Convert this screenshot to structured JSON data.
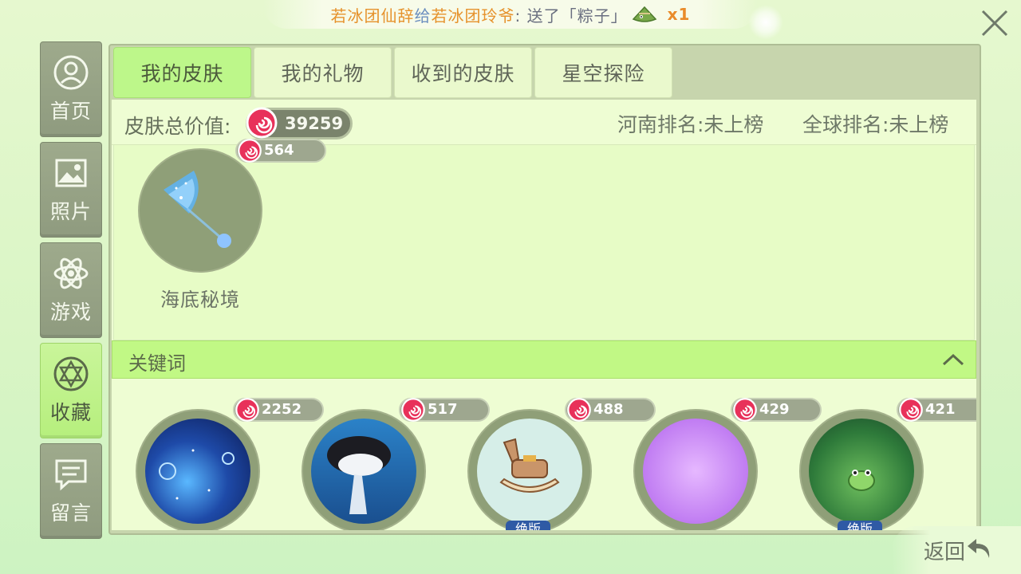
{
  "notification": {
    "sender": "若冰团仙辞",
    "connector": "给",
    "receiver": "若冰团玲爷",
    "message": ":  送了「粽子」",
    "gift_icon": "zongzi-icon",
    "count": "x1"
  },
  "sidebar": {
    "items": [
      {
        "label": "首页",
        "icon": "profile-icon"
      },
      {
        "label": "照片",
        "icon": "photo-icon"
      },
      {
        "label": "游戏",
        "icon": "atom-icon"
      },
      {
        "label": "收藏",
        "icon": "collection-icon",
        "active": true
      },
      {
        "label": "留言",
        "icon": "message-icon"
      }
    ]
  },
  "tabs": [
    "我的皮肤",
    "我的礼物",
    "收到的皮肤",
    "星空探险"
  ],
  "summary": {
    "total_label": "皮肤总价值:",
    "total_value": "39259",
    "henan_rank": "河南排名:未上榜",
    "global_rank": "全球排名:未上榜"
  },
  "my_skins": [
    {
      "name": "海底秘境",
      "price": "564"
    }
  ],
  "keyword_section": {
    "label": "关键词",
    "expanded": true
  },
  "keyword_skins": [
    {
      "price": "2252",
      "badge": ""
    },
    {
      "price": "517",
      "badge": ""
    },
    {
      "price": "488",
      "badge": "绝版"
    },
    {
      "price": "429",
      "badge": ""
    },
    {
      "price": "421",
      "badge": "绝版"
    }
  ],
  "back_label": "返回",
  "colors": {
    "accent_green": "#bdf78a",
    "coin_red": "#e8315a",
    "orange_text": "#e6922c",
    "blue_text": "#6d8fbf"
  }
}
